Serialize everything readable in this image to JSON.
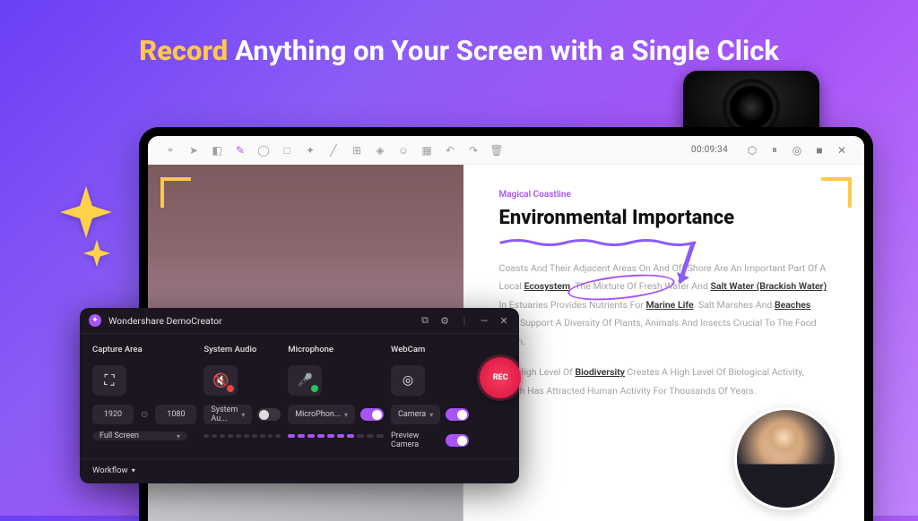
{
  "hero": {
    "accent": "Record",
    "rest": " Anything on Your Screen with a Single Click"
  },
  "toolbar": {
    "timer": "00:09:34",
    "icons": [
      "cursor",
      "arrow",
      "eraser",
      "highlighter",
      "circle",
      "square",
      "wand",
      "line",
      "text-box",
      "shapes",
      "stamp",
      "grid",
      "undo",
      "redo",
      "trash"
    ],
    "right_icons": [
      "shield",
      "pause",
      "target",
      "record",
      "stop",
      "close"
    ]
  },
  "article": {
    "kicker": "Magical Coastline",
    "title": "Environmental Importance",
    "p1a": "Coasts And Their Adjacent Areas On And Off Shore Are An Important Part Of A Local ",
    "p1b": "Ecosystem",
    "p1c": ". The Mixture Of Fresh Water And ",
    "p1d": "Salt Water (Brackish Water)",
    "p1e": " In Estuaries Provides Nutrients For ",
    "p1f": "Marine Life",
    "p1g": ". Salt Marshes And ",
    "p1h": "Beaches",
    "p1i": " Also Support A Diversity Of Plants, Animals And Insects Crucial To The Food Chain.",
    "p2a": "The High Level Of ",
    "p2b": "Biodiversity",
    "p2c": " Creates A High Level Of Biological Activity, Which Has Attracted Human Activity For Thousands Of Years."
  },
  "recorder": {
    "title": "Wondershare DemoCreator",
    "capture": {
      "label": "Capture Area",
      "w": "1920",
      "h": "1080",
      "mode": "Full Screen"
    },
    "audio": {
      "label": "System Audio",
      "sel": "System Au..."
    },
    "mic": {
      "label": "Microphone",
      "sel": "MicroPhon..."
    },
    "cam": {
      "label": "WebCam",
      "sel": "Camera",
      "preview": "Preview Camera"
    },
    "rec": "REC",
    "workflow": "Workflow"
  }
}
